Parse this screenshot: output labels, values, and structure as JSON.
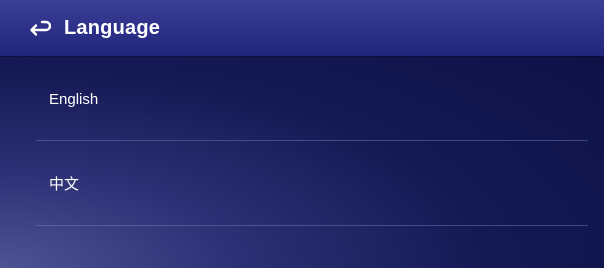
{
  "header": {
    "title": "Language",
    "back_icon": "return-arrow-icon"
  },
  "languages": [
    {
      "label": "English"
    },
    {
      "label": "中文"
    }
  ],
  "colors": {
    "header": "#2c3088",
    "background": "#161a55",
    "text": "#ffffff",
    "divider": "#4e5590"
  }
}
